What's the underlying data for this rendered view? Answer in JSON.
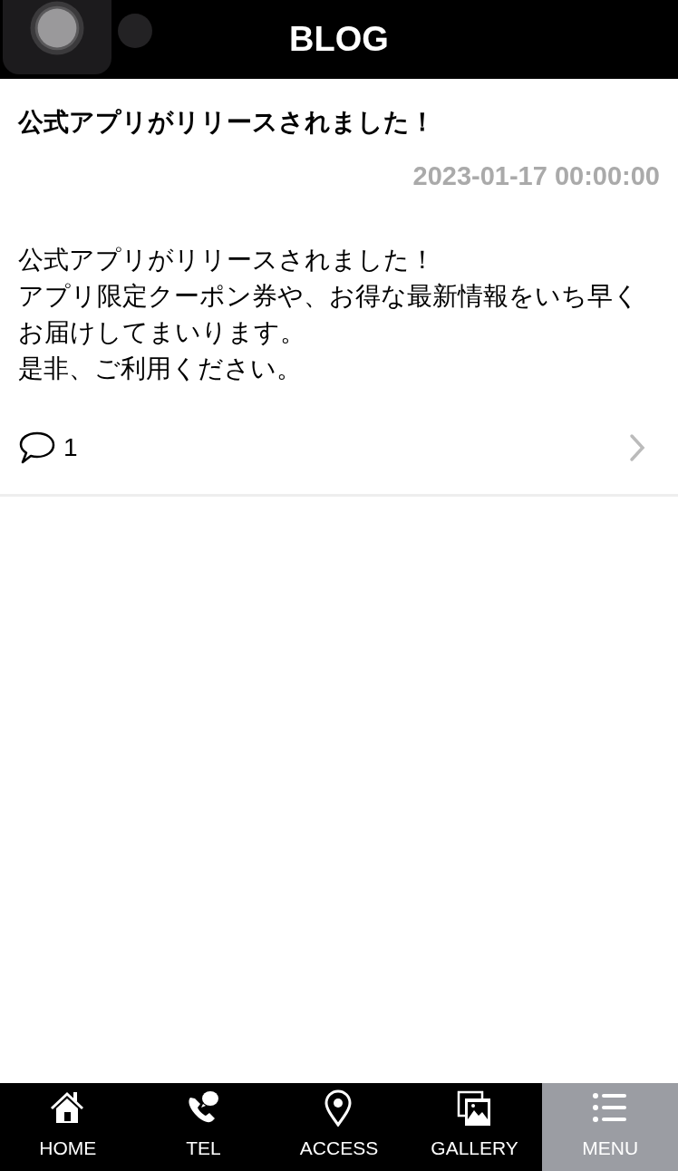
{
  "header": {
    "title": "BLOG"
  },
  "post": {
    "title": "公式アプリがリリースされました！",
    "date": "2023-01-17 00:00:00",
    "body": [
      "公式アプリがリリースされました！",
      "アプリ限定クーポン券や、お得な最新情報をいち早くお届けしてまいります。",
      "是非、ご利用ください。"
    ],
    "comment_count": "1"
  },
  "tabs": [
    {
      "label": "HOME",
      "kind": "home",
      "selected": false
    },
    {
      "label": "TEL",
      "kind": "tel",
      "selected": false
    },
    {
      "label": "ACCESS",
      "kind": "access",
      "selected": false
    },
    {
      "label": "GALLERY",
      "kind": "gallery",
      "selected": false
    },
    {
      "label": "MENU",
      "kind": "menu",
      "selected": true
    }
  ]
}
